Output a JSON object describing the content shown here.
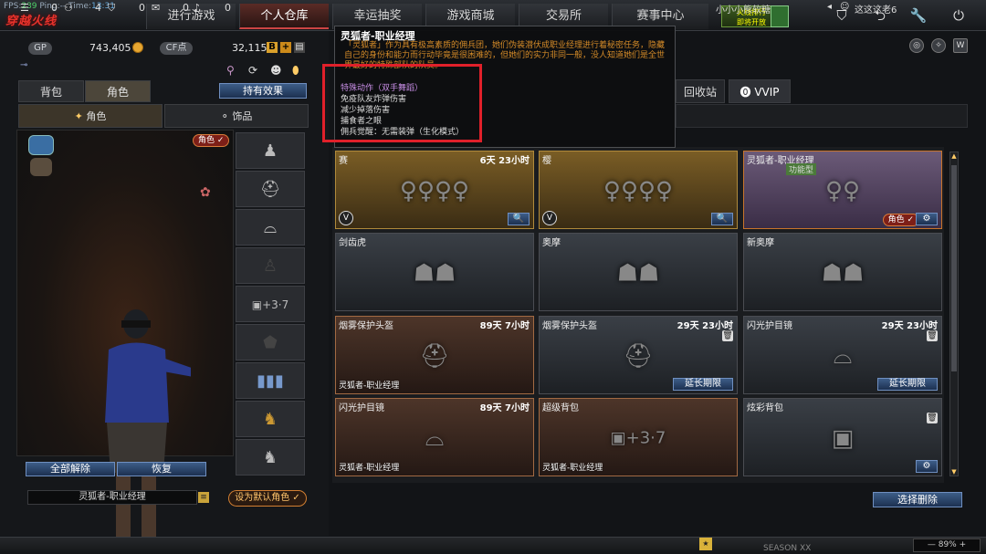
{
  "debug": {
    "fps_label": "FPS:",
    "fps": "239",
    "ping_label": "Ping:",
    "ping": "--",
    "time_label": "Time:",
    "time": "13:31"
  },
  "logo": "穿越火线",
  "nav": [
    {
      "label": "进行游戏"
    },
    {
      "label": "个人仓库",
      "active": true
    },
    {
      "label": "幸运抽奖"
    },
    {
      "label": "游戏商城"
    },
    {
      "label": "交易所"
    },
    {
      "label": "赛事中心"
    }
  ],
  "event_badge": {
    "line1": "火线排行",
    "line2": "即将开放"
  },
  "currency": {
    "gp_label": "GP",
    "gp_value": "743,405",
    "cf_label": "CF点",
    "cf_value": "32,115",
    "plus": "+",
    "cf_icon": "B"
  },
  "left_tabs": {
    "bag": "背包",
    "role": "角色",
    "owned_effect": "持有效果"
  },
  "sub_tabs": {
    "role": "角色",
    "accessory": "饰品"
  },
  "role_badge": "角色 ✓",
  "bottom": {
    "release_all": "全部解除",
    "restore": "恢复",
    "char_name": "灵狐者-职业经理",
    "set_default": "设为默认角色"
  },
  "tooltip": {
    "title": "灵狐者-职业经理",
    "desc": "「灵狐者」作为具有极高素质的佣兵团，她们伪装潜伏成职业经理进行着秘密任务，隐藏自己的身份和能力而行动毕竟是很困难的，但她们的实力非同一般，没人知道她们是全世界最好的特殊部队的队员。",
    "lines": [
      "特殊动作（双手舞蹈）",
      "免疫队友炸弹伤害",
      "减少掉落伤害",
      "捕食者之眼",
      "佣兵觉醒：无需装弹（生化模式）"
    ]
  },
  "right_tabs": {
    "recycle": "回收站",
    "vvip": "VVIP"
  },
  "cards": [
    {
      "name": "赛",
      "time": "6天 23小时",
      "theme": "gold",
      "action": "🔍"
    },
    {
      "name": "樱",
      "time": "",
      "theme": "gold",
      "action": "🔍"
    },
    {
      "name": "灵狐者-职业经理",
      "time": "",
      "theme": "purple",
      "badge": "角色 ✓",
      "sub": "功能型",
      "action": "⚙"
    },
    {
      "name": "剑齿虎",
      "time": "",
      "theme": "steel"
    },
    {
      "name": "奥摩",
      "time": "",
      "theme": "steel"
    },
    {
      "name": "新奥摩",
      "time": "",
      "theme": "steel"
    },
    {
      "name": "烟雾保护头盔",
      "time": "89天 7小时",
      "theme": "copper",
      "tag": "灵狐者-职业经理"
    },
    {
      "name": "烟雾保护头盔",
      "time": "29天 23小时",
      "theme": "steel",
      "ext": "延长期限"
    },
    {
      "name": "闪光护目镜",
      "time": "29天 23小时",
      "theme": "steel",
      "ext": "延长期限"
    },
    {
      "name": "闪光护目镜",
      "time": "89天 7小时",
      "theme": "copper",
      "tag": "灵狐者-职业经理"
    },
    {
      "name": "超级背包",
      "time": "",
      "theme": "copper",
      "tag": "灵狐者-职业经理"
    },
    {
      "name": "炫彩背包",
      "time": "",
      "theme": "steel",
      "action": "⚙"
    }
  ],
  "select_delete": "选择删除",
  "statusbar": {
    "v1": "0",
    "v2": "4",
    "v3": "0",
    "v4": "0",
    "v5": "0",
    "player": "小小小熊软糖",
    "season": "SEASON XX",
    "buddy": "这这这老6",
    "zoom": "89%"
  }
}
